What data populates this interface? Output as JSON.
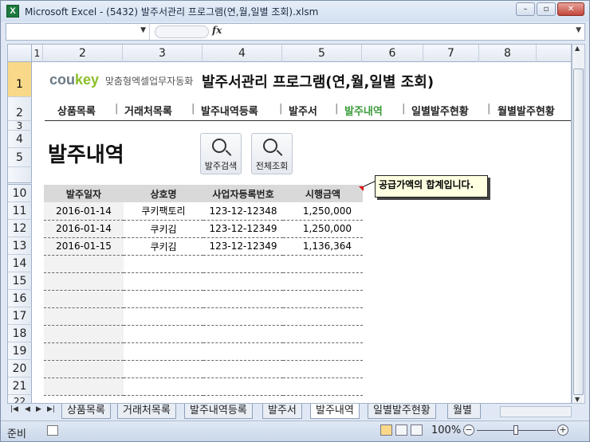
{
  "window": {
    "title": "Microsoft Excel - (5432) 발주서관리 프로그램(연,월,일별 조회).xlsm",
    "app_icon": "X"
  },
  "formula_bar": {
    "name_box": "",
    "fx_label": "fx",
    "content": ""
  },
  "columns": [
    "1",
    "2",
    "3",
    "4",
    "5",
    "6",
    "7",
    "8"
  ],
  "rows": [
    "1",
    "2",
    "3",
    "4",
    "5",
    "10",
    "11",
    "12",
    "13",
    "14",
    "15",
    "16",
    "17",
    "18",
    "19",
    "20",
    "21",
    "22"
  ],
  "brand": {
    "logo_gray": "cou",
    "logo_green": "key",
    "tagline": "맞춤형엑셀업무자동화"
  },
  "page_title": "발주서관리 프로그램(연,월,일별 조회)",
  "menu": {
    "items": [
      "상품목록",
      "거래처목록",
      "발주내역등록",
      "발주서",
      "발주내역",
      "일별발주현황",
      "월별발주현황"
    ],
    "active": "발주내역"
  },
  "section_heading": "발주내역",
  "buttons": {
    "order_search": "발주검색",
    "full_search": "전체조회"
  },
  "table": {
    "headers": [
      "발주일자",
      "상호명",
      "사업자등록번호",
      "시행금액"
    ],
    "rows": [
      [
        "2016-01-14",
        "쿠키팩토리",
        "123-12-12348",
        "1,250,000"
      ],
      [
        "2016-01-14",
        "쿠키김",
        "123-12-12349",
        "1,250,000"
      ],
      [
        "2016-01-15",
        "쿠키김",
        "123-12-12349",
        "1,136,364"
      ]
    ],
    "empty_rows": 8
  },
  "comment": "공급가액의 합계입니다.",
  "sheet_tabs": [
    "상품목록",
    "거래처목록",
    "발주내역등록",
    "발주서",
    "발주내역",
    "일별발주현황",
    "월별"
  ],
  "active_sheet": "발주내역",
  "status": {
    "ready": "준비",
    "zoom": "100%"
  },
  "colors": {
    "accent_green": "#3a9c3a",
    "selected_row": "#f9d989",
    "header_gray": "#d9d9d9"
  }
}
